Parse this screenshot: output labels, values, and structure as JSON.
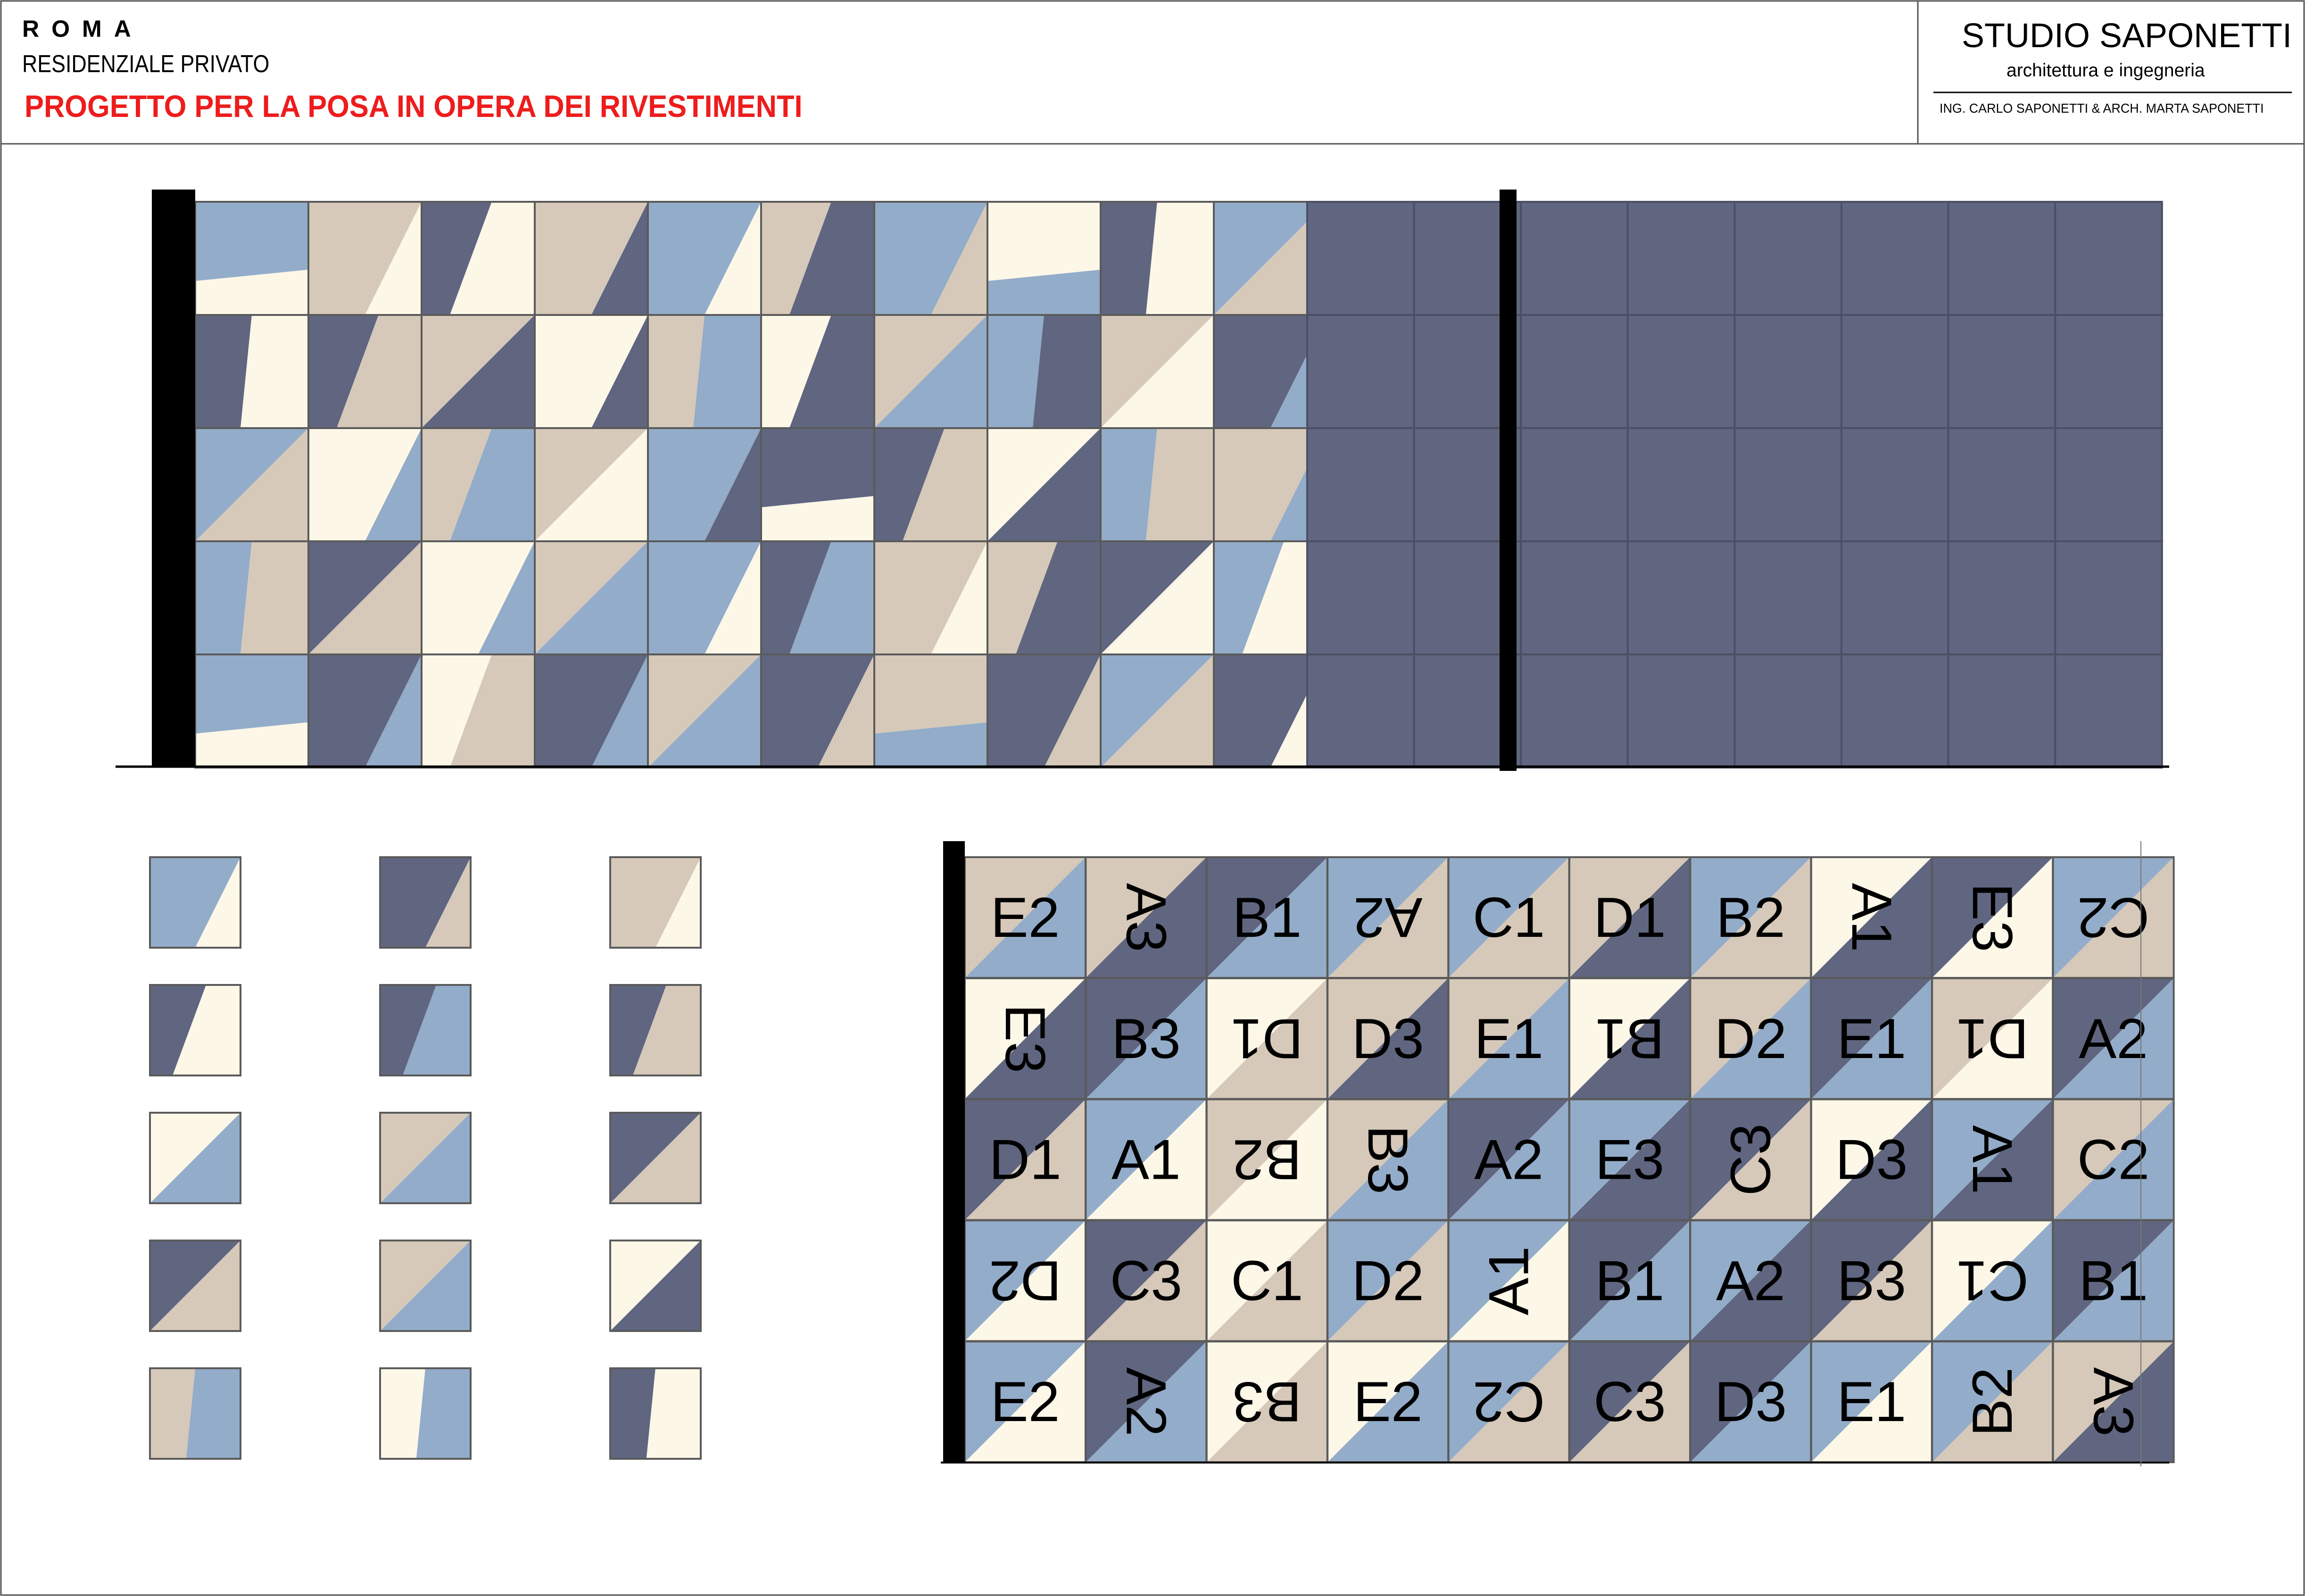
{
  "header": {
    "city": "ROMA",
    "project_type": "RESIDENZIALE PRIVATO",
    "project_title": "PROGETTO PER LA POSA IN OPERA DEI RIVESTIMENTI",
    "studio_name": "STUDIO SAPONETTI",
    "studio_subtitle": "architettura e ingegneria",
    "engineers": "ING. CARLO SAPONETTI & ARCH. MARTA SAPONETTI"
  },
  "colors": {
    "dark": "#606680",
    "blue": "#93acc9",
    "beige": "#d6c9b9",
    "cream": "#fdf7e8",
    "title_red": "#ee1c1c"
  },
  "front_wall": {
    "rows": [
      [
        [
          "h",
          "blue",
          "cream"
        ],
        [
          "dd",
          "beige",
          "cream"
        ],
        [
          "d2",
          "dark",
          "cream"
        ],
        [
          "dd",
          "beige",
          "dark"
        ],
        [
          "dd",
          "blue",
          "cream"
        ],
        [
          "d2",
          "beige",
          "dark"
        ],
        [
          "dd",
          "blue",
          "beige"
        ],
        [
          "h",
          "cream",
          "blue"
        ],
        [
          "v",
          "dark",
          "cream"
        ],
        [
          "du",
          "blue",
          "beige"
        ]
      ],
      [
        [
          "v",
          "dark",
          "cream"
        ],
        [
          "d2",
          "dark",
          "beige"
        ],
        [
          "du",
          "beige",
          "dark"
        ],
        [
          "dd",
          "cream",
          "dark"
        ],
        [
          "v",
          "beige",
          "blue"
        ],
        [
          "d2",
          "cream",
          "dark"
        ],
        [
          "du",
          "beige",
          "blue"
        ],
        [
          "v",
          "blue",
          "dark"
        ],
        [
          "du",
          "beige",
          "cream"
        ],
        [
          "dd",
          "dark",
          "blue"
        ]
      ],
      [
        [
          "du",
          "blue",
          "beige"
        ],
        [
          "dd",
          "cream",
          "blue"
        ],
        [
          "d2",
          "beige",
          "blue"
        ],
        [
          "du",
          "beige",
          "cream"
        ],
        [
          "dd",
          "blue",
          "dark"
        ],
        [
          "h",
          "dark",
          "cream"
        ],
        [
          "d2",
          "dark",
          "beige"
        ],
        [
          "du",
          "cream",
          "dark"
        ],
        [
          "v",
          "blue",
          "beige"
        ],
        [
          "dd",
          "beige",
          "blue"
        ]
      ],
      [
        [
          "v",
          "blue",
          "beige"
        ],
        [
          "du",
          "dark",
          "beige"
        ],
        [
          "dd",
          "cream",
          "blue"
        ],
        [
          "du",
          "beige",
          "blue"
        ],
        [
          "dd",
          "blue",
          "cream"
        ],
        [
          "d2",
          "dark",
          "blue"
        ],
        [
          "dd",
          "beige",
          "cream"
        ],
        [
          "d2",
          "beige",
          "dark"
        ],
        [
          "du",
          "dark",
          "cream"
        ],
        [
          "d2",
          "blue",
          "cream"
        ]
      ],
      [
        [
          "h",
          "blue",
          "cream"
        ],
        [
          "dd",
          "dark",
          "blue"
        ],
        [
          "d2",
          "cream",
          "beige"
        ],
        [
          "dd",
          "dark",
          "blue"
        ],
        [
          "du",
          "beige",
          "blue"
        ],
        [
          "dd",
          "dark",
          "beige"
        ],
        [
          "h",
          "beige",
          "blue"
        ],
        [
          "dd",
          "dark",
          "beige"
        ],
        [
          "du",
          "blue",
          "beige"
        ],
        [
          "dd",
          "dark",
          "cream"
        ]
      ]
    ]
  },
  "side_wall": {
    "rows": 5,
    "cols": 8,
    "color": "dark"
  },
  "legend_tiles": [
    [
      [
        "dd",
        "blue",
        "cream"
      ],
      [
        "dd",
        "dark",
        "beige"
      ],
      [
        "dd",
        "beige",
        "cream"
      ]
    ],
    [
      [
        "d2",
        "dark",
        "cream"
      ],
      [
        "d2",
        "dark",
        "blue"
      ],
      [
        "d2",
        "dark",
        "beige"
      ]
    ],
    [
      [
        "du",
        "cream",
        "blue"
      ],
      [
        "du",
        "beige",
        "blue"
      ],
      [
        "du",
        "dark",
        "beige"
      ]
    ],
    [
      [
        "du",
        "dark",
        "beige"
      ],
      [
        "du",
        "beige",
        "blue"
      ],
      [
        "du",
        "cream",
        "dark"
      ]
    ],
    [
      [
        "v",
        "beige",
        "blue"
      ],
      [
        "v",
        "cream",
        "blue"
      ],
      [
        "v",
        "dark",
        "cream"
      ]
    ]
  ],
  "code_grid": {
    "rows": [
      [
        [
          "E2",
          0,
          "beige",
          "blue"
        ],
        [
          "A3",
          90,
          "beige",
          "dark"
        ],
        [
          "B1",
          0,
          "dark",
          "blue"
        ],
        [
          "A2",
          180,
          "blue",
          "beige"
        ],
        [
          "C1",
          0,
          "blue",
          "beige"
        ],
        [
          "D1",
          0,
          "beige",
          "dark"
        ],
        [
          "B2",
          0,
          "blue",
          "beige"
        ],
        [
          "A1",
          90,
          "cream",
          "dark"
        ],
        [
          "E3",
          90,
          "dark",
          "cream"
        ],
        [
          "C2",
          180,
          "blue",
          "beige"
        ]
      ],
      [
        [
          "E3",
          90,
          "cream",
          "dark"
        ],
        [
          "B3",
          0,
          "dark",
          "blue"
        ],
        [
          "D1",
          180,
          "cream",
          "beige"
        ],
        [
          "D3",
          0,
          "beige",
          "dark"
        ],
        [
          "E1",
          0,
          "beige",
          "blue"
        ],
        [
          "B1",
          180,
          "cream",
          "dark"
        ],
        [
          "D2",
          0,
          "beige",
          "blue"
        ],
        [
          "E1",
          0,
          "dark",
          "blue"
        ],
        [
          "D1",
          180,
          "beige",
          "cream"
        ],
        [
          "A2",
          0,
          "dark",
          "blue"
        ]
      ],
      [
        [
          "D1",
          0,
          "dark",
          "beige"
        ],
        [
          "A1",
          0,
          "blue",
          "cream"
        ],
        [
          "B2",
          180,
          "beige",
          "cream"
        ],
        [
          "B3",
          90,
          "beige",
          "blue"
        ],
        [
          "A2",
          0,
          "dark",
          "blue"
        ],
        [
          "E3",
          0,
          "blue",
          "dark"
        ],
        [
          "C3",
          270,
          "dark",
          "beige"
        ],
        [
          "D3",
          0,
          "cream",
          "dark"
        ],
        [
          "A1",
          90,
          "blue",
          "dark"
        ],
        [
          "C2",
          0,
          "beige",
          "blue"
        ]
      ],
      [
        [
          "D2",
          180,
          "blue",
          "cream"
        ],
        [
          "C3",
          0,
          "dark",
          "beige"
        ],
        [
          "C1",
          0,
          "cream",
          "beige"
        ],
        [
          "D2",
          0,
          "blue",
          "beige"
        ],
        [
          "A1",
          270,
          "blue",
          "cream"
        ],
        [
          "B1",
          0,
          "dark",
          "blue"
        ],
        [
          "A2",
          0,
          "blue",
          "dark"
        ],
        [
          "B3",
          0,
          "dark",
          "beige"
        ],
        [
          "C1",
          180,
          "cream",
          "blue"
        ],
        [
          "B1",
          0,
          "dark",
          "blue"
        ]
      ],
      [
        [
          "E2",
          0,
          "blue",
          "cream"
        ],
        [
          "A2",
          90,
          "dark",
          "blue"
        ],
        [
          "B3",
          180,
          "cream",
          "beige"
        ],
        [
          "E2",
          0,
          "cream",
          "blue"
        ],
        [
          "C2",
          180,
          "blue",
          "beige"
        ],
        [
          "C3",
          0,
          "dark",
          "beige"
        ],
        [
          "D3",
          0,
          "dark",
          "blue"
        ],
        [
          "E1",
          0,
          "blue",
          "cream"
        ],
        [
          "B2",
          270,
          "blue",
          "beige"
        ],
        [
          "A3",
          90,
          "beige",
          "dark"
        ]
      ]
    ]
  }
}
